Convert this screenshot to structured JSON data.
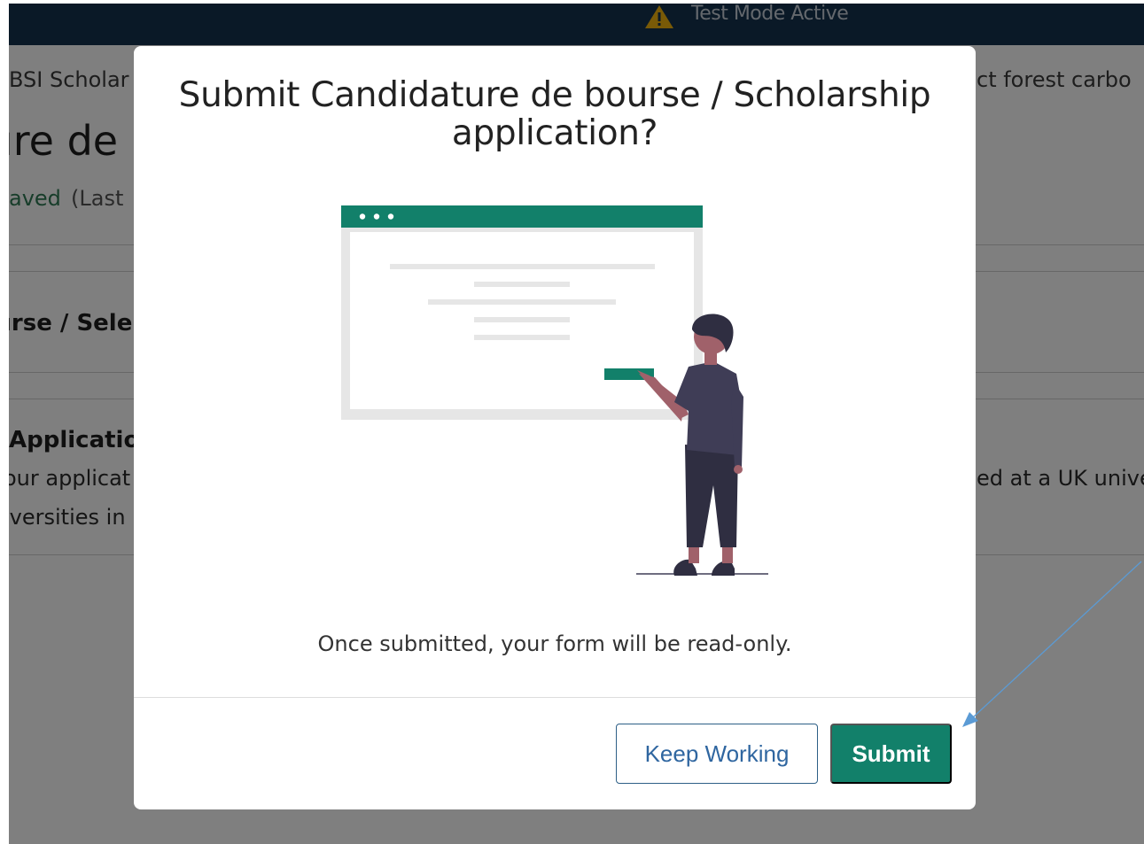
{
  "banner": {
    "text": "Test Mode Active",
    "icon": "warning-triangle-icon"
  },
  "background": {
    "breadcrumb_left": "BSI Scholar",
    "breadcrumb_right": "ct forest carbo",
    "page_title": "ıre de",
    "saved_status": "aved",
    "last_saved": "(Last",
    "section_title": "ırse / Sele",
    "application": {
      "title": "Application",
      "line1": "our applicat",
      "line2": "iversities in",
      "right_fragment": "ed at a UK unive"
    }
  },
  "modal": {
    "title": "Submit Candidature de bourse / Scholarship application?",
    "message": "Once submitted, your form will be read-only.",
    "keep_working_label": "Keep Working",
    "submit_label": "Submit"
  },
  "colors": {
    "banner_bg": "#14324f",
    "accent_green": "#12806a",
    "link_blue": "#2f66a0",
    "annotation_arrow": "#5b9bd5"
  }
}
